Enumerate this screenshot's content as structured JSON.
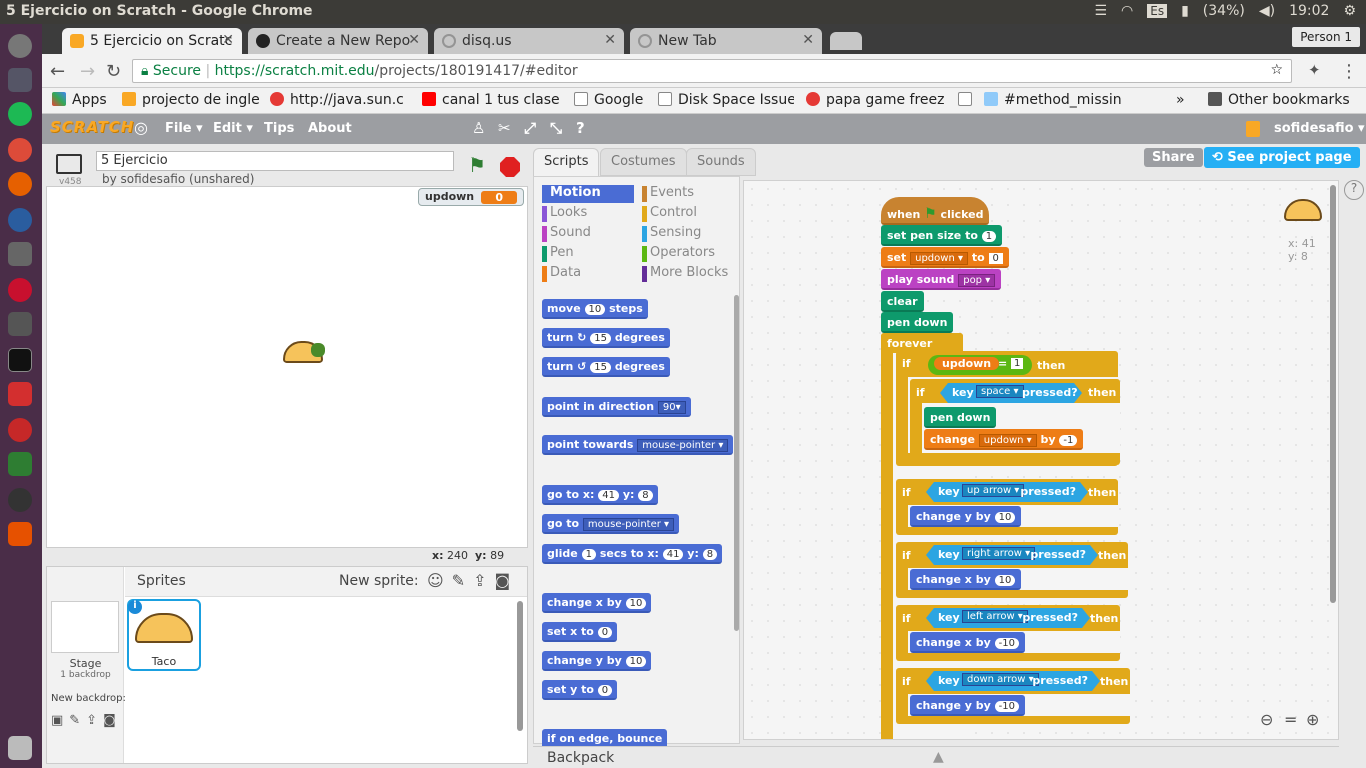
{
  "window": {
    "title": "5 Ejercicio on Scratch - Google Chrome"
  },
  "system": {
    "keyboard": "Es",
    "battery": "(34%)",
    "clock": "19:02"
  },
  "tabs": [
    {
      "label": "5 Ejercicio on Scratc"
    },
    {
      "label": "Create a New Repo"
    },
    {
      "label": "disq.us"
    },
    {
      "label": "New Tab"
    }
  ],
  "profile": "Person 1",
  "address": {
    "secure": "Secure",
    "scheme_host": "https://scratch.mit.edu",
    "path": "/projects/180191417/#editor"
  },
  "bookmarks": [
    "Apps",
    "projecto de ingle",
    "http://java.sun.c",
    "canal 1 tus clase",
    "Google",
    "Disk Space Issue",
    "papa game freez",
    "#method_missin",
    "»",
    "Other bookmarks"
  ],
  "scratch_menu": {
    "logo": "SCRATCH",
    "file": "File ▾",
    "edit": "Edit ▾",
    "tips": "Tips",
    "about": "About",
    "user": "sofidesafio ▾"
  },
  "project": {
    "title": "5 Ejercicio",
    "byline": "by sofidesafio (unshared)",
    "version": "v458"
  },
  "monitor": {
    "label": "updown",
    "value": "0"
  },
  "stage_coords": {
    "x_label": "x:",
    "x": "240",
    "y_label": "y:",
    "y": "89"
  },
  "sprites_pane": {
    "title": "Sprites",
    "new_sprite": "New sprite:",
    "stage_label": "Stage",
    "stage_sub": "1 backdrop",
    "new_backdrop": "New backdrop:",
    "sprite_name": "Taco"
  },
  "editor_tabs": [
    "Scripts",
    "Costumes",
    "Sounds"
  ],
  "share": "Share",
  "see_project": "See project page",
  "categories": {
    "left": [
      "Motion",
      "Looks",
      "Sound",
      "Pen",
      "Data"
    ],
    "right": [
      "Events",
      "Control",
      "Sensing",
      "Operators",
      "More Blocks"
    ],
    "colors_left": [
      "#4a6cd4",
      "#8a55d7",
      "#bb42c3",
      "#0e9a6c",
      "#ee7d16"
    ],
    "colors_right": [
      "#c88330",
      "#e1a91a",
      "#2ca5e2",
      "#5cb712",
      "#632d99"
    ]
  },
  "palette_blocks": [
    {
      "a": "move",
      "n1": "10",
      "b": "steps"
    },
    {
      "a": "turn ↻",
      "n1": "15",
      "b": "degrees"
    },
    {
      "a": "turn ↺",
      "n1": "15",
      "b": "degrees"
    },
    {
      "a": "point in direction",
      "d": "90▾"
    },
    {
      "a": "point towards",
      "d": "mouse-pointer ▾"
    },
    {
      "a": "go to x:",
      "n1": "41",
      "b": "y:",
      "n2": "8"
    },
    {
      "a": "go to",
      "d": "mouse-pointer ▾"
    },
    {
      "a": "glide",
      "n1": "1",
      "b": "secs to x:",
      "n2": "41",
      "c": "y:",
      "n3": "8"
    },
    {
      "a": "change x by",
      "n1": "10"
    },
    {
      "a": "set x to",
      "n1": "0"
    },
    {
      "a": "change y by",
      "n1": "10"
    },
    {
      "a": "set y to",
      "n1": "0"
    },
    {
      "a": "if on edge, bounce"
    }
  ],
  "sprite_info": {
    "x_label": "x:",
    "x": "41",
    "y_label": "y:",
    "y": "8"
  },
  "script": {
    "hat": {
      "a": "when",
      "b": "clicked"
    },
    "pen_size": {
      "a": "set pen size to",
      "v": "1"
    },
    "set_var": {
      "a": "set",
      "var": "updown ▾",
      "b": "to",
      "v": "0"
    },
    "play_sound": {
      "a": "play sound",
      "d": "pop ▾"
    },
    "clear": "clear",
    "pen_down": "pen down",
    "forever": "forever",
    "if1": {
      "a": "if",
      "var": "updown",
      "op": "=",
      "v": "1",
      "b": "then"
    },
    "if_space": {
      "a": "if",
      "k": "key",
      "key": "space ▾",
      "p": "pressed?",
      "b": "then"
    },
    "pen_down2": "pen down",
    "change_var": {
      "a": "change",
      "var": "updown ▾",
      "b": "by",
      "v": "-1"
    },
    "if_up": {
      "a": "if",
      "k": "key",
      "key": "up arrow ▾",
      "p": "pressed?",
      "b": "then",
      "ca": "change y by",
      "cv": "10"
    },
    "if_right": {
      "a": "if",
      "k": "key",
      "key": "right arrow ▾",
      "p": "pressed?",
      "b": "then",
      "ca": "change x by",
      "cv": "10"
    },
    "if_left": {
      "a": "if",
      "k": "key",
      "key": "left arrow ▾",
      "p": "pressed?",
      "b": "then",
      "ca": "change x by",
      "cv": "-10"
    },
    "if_down": {
      "a": "if",
      "k": "key",
      "key": "down arrow ▾",
      "p": "pressed?",
      "b": "then",
      "ca": "change y by",
      "cv": "-10"
    }
  },
  "backpack": "Backpack"
}
